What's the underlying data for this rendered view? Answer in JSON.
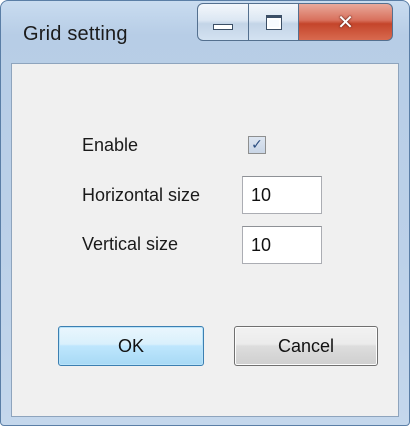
{
  "window": {
    "title": "Grid setting",
    "caption_icons": [
      "minimize-icon",
      "maximize-icon",
      "close-icon"
    ]
  },
  "form": {
    "enable_label": "Enable",
    "enable_checked": true,
    "horizontal_label": "Horizontal size",
    "horizontal_value": "10",
    "vertical_label": "Vertical size",
    "vertical_value": "10"
  },
  "buttons": {
    "ok_label": "OK",
    "cancel_label": "Cancel"
  },
  "colors": {
    "frame": "#bcd1e9",
    "client": "#f0f0f0",
    "close_button": "#c4452b",
    "default_button": "#bee6fd"
  }
}
